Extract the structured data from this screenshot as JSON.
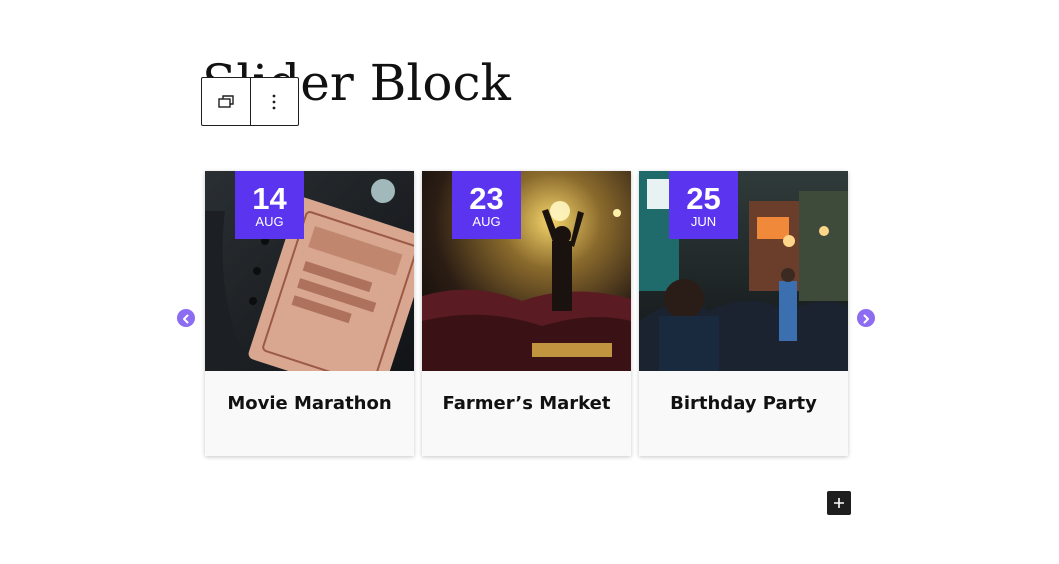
{
  "page": {
    "title": "Slider Block"
  },
  "toolbar": {
    "items": [
      {
        "icon": "transform-icon"
      },
      {
        "icon": "more-vertical-icon"
      }
    ]
  },
  "slider": {
    "accent_color": "#5b34f0",
    "arrow_color": "#8c6cf0",
    "prev_icon": "chevron-left-icon",
    "next_icon": "chevron-right-icon",
    "cards": [
      {
        "day": "14",
        "month": "AUG",
        "title": "Movie Marathon",
        "image": "ticket-coupon-photo"
      },
      {
        "day": "23",
        "month": "AUG",
        "title": "Farmer’s Market",
        "image": "concert-stage-photo"
      },
      {
        "day": "25",
        "month": "JUN",
        "title": "Birthday Party",
        "image": "night-street-crowd-photo"
      }
    ]
  },
  "inserter": {
    "icon": "plus-icon"
  }
}
